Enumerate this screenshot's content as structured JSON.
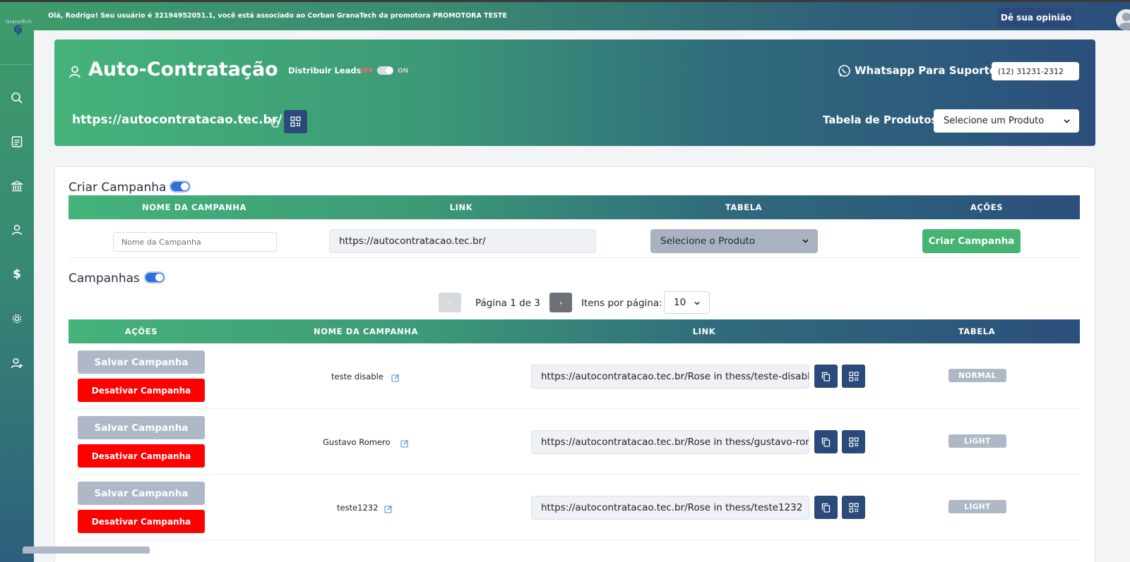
{
  "topbar": {
    "welcome": "Olá, Rodrigo! Seu usuário é 32194952051.1, você está associado ao Corban GranaTech da promotora PROMOTORA TESTE",
    "opinion_button": "Dê sua opinião"
  },
  "sidebar": {
    "logo_letters": "G",
    "logo_letter2": "T",
    "logo_text": "GranaTech",
    "items": [
      {
        "icon": "search-icon"
      },
      {
        "icon": "document-icon"
      },
      {
        "icon": "bank-icon"
      },
      {
        "icon": "user-icon"
      },
      {
        "icon": "dollar-icon",
        "label": "$"
      },
      {
        "icon": "gear-icon"
      },
      {
        "icon": "user-add-icon"
      }
    ]
  },
  "header": {
    "title": "Auto-Contratação",
    "distribuir_label": "Distribuir Leads",
    "off_label": "OFF",
    "on_label": "ON",
    "whatsapp_label": "Whatsapp Para Suporte:",
    "whatsapp_value": "(12) 31231-2312",
    "url": "https://autocontratacao.tec.br/",
    "tabela_label": "Tabela de Produtos:",
    "produto_select": "Selecione um Produto"
  },
  "criar": {
    "title": "Criar Campanha",
    "columns": [
      "NOME DA CAMPANHA",
      "LINK",
      "TABELA",
      "AÇÕES"
    ],
    "nome_placeholder": "Nome da Campanha",
    "link_value": "https://autocontratacao.tec.br/",
    "produto_select": "Selecione o Produto",
    "criar_button": "Criar Campanha"
  },
  "campanhas": {
    "title": "Campanhas",
    "pager_prev": "‹",
    "pager_next": "›",
    "page_text": "Página 1 de 3",
    "itens_label": "Itens por página:",
    "itens_value": "10",
    "columns": [
      "AÇÕES",
      "NOME DA CAMPANHA",
      "LINK",
      "TABELA"
    ],
    "save_label": "Salvar Campanha",
    "deactivate_label": "Desativar Campanha",
    "rows": [
      {
        "name": "teste disable",
        "link": "https://autocontratacao.tec.br/Rose in thess/teste-disable",
        "tabela": "NORMAL"
      },
      {
        "name": "Gustavo Romero",
        "link": "https://autocontratacao.tec.br/Rose in thess/gustavo-romero",
        "tabela": "LIGHT"
      },
      {
        "name": "teste1232",
        "link": "https://autocontratacao.tec.br/Rose in thess/teste1232",
        "tabela": "LIGHT"
      }
    ]
  },
  "colors": {
    "brand_green": "#45b37a",
    "brand_blue": "#2b4a7a",
    "danger": "#ff0000"
  }
}
